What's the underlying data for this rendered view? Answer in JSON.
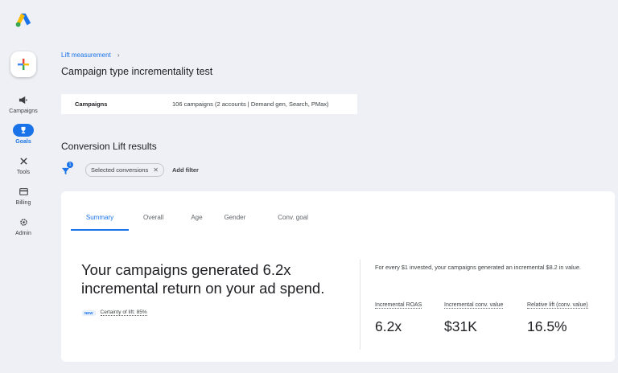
{
  "nav": {
    "items": [
      {
        "label": "Campaigns",
        "icon": "megaphone-icon"
      },
      {
        "label": "Goals",
        "icon": "trophy-icon"
      },
      {
        "label": "Tools",
        "icon": "tools-icon"
      },
      {
        "label": "Billing",
        "icon": "credit-card-icon"
      },
      {
        "label": "Admin",
        "icon": "gear-icon"
      }
    ],
    "active": "Goals",
    "accent": "#1a73e8"
  },
  "breadcrumb": {
    "label": "Lift measurement"
  },
  "page": {
    "title": "Campaign type incrementality test"
  },
  "campaigns": {
    "label": "Campaigns",
    "value": "106 campaigns (2 accounts | Demand gen, Search, PMax)"
  },
  "results": {
    "title": "Conversion Lift results",
    "filter_count": "1",
    "filter_chip": "Selected conversions",
    "add_filter": "Add filter",
    "tabs": [
      "Summary",
      "Overall",
      "Age",
      "Gender",
      "Conv. goal"
    ],
    "active_tab": "Summary",
    "headline_1": "Your campaigns generated 6.2x",
    "headline_2": "incremental return on your ad spend.",
    "new_badge": "NEW",
    "certainty": "Certainty of lift: 85%",
    "invest_text": "For every $1 invested, your campaigns generated an incremental $8.2 in value.",
    "metrics": [
      {
        "label": "Incremental ROAS",
        "value": "6.2x"
      },
      {
        "label": "Incremental conv. value",
        "value": "$31K"
      },
      {
        "label": "Relative lift (conv. value)",
        "value": "16.5%"
      }
    ]
  }
}
